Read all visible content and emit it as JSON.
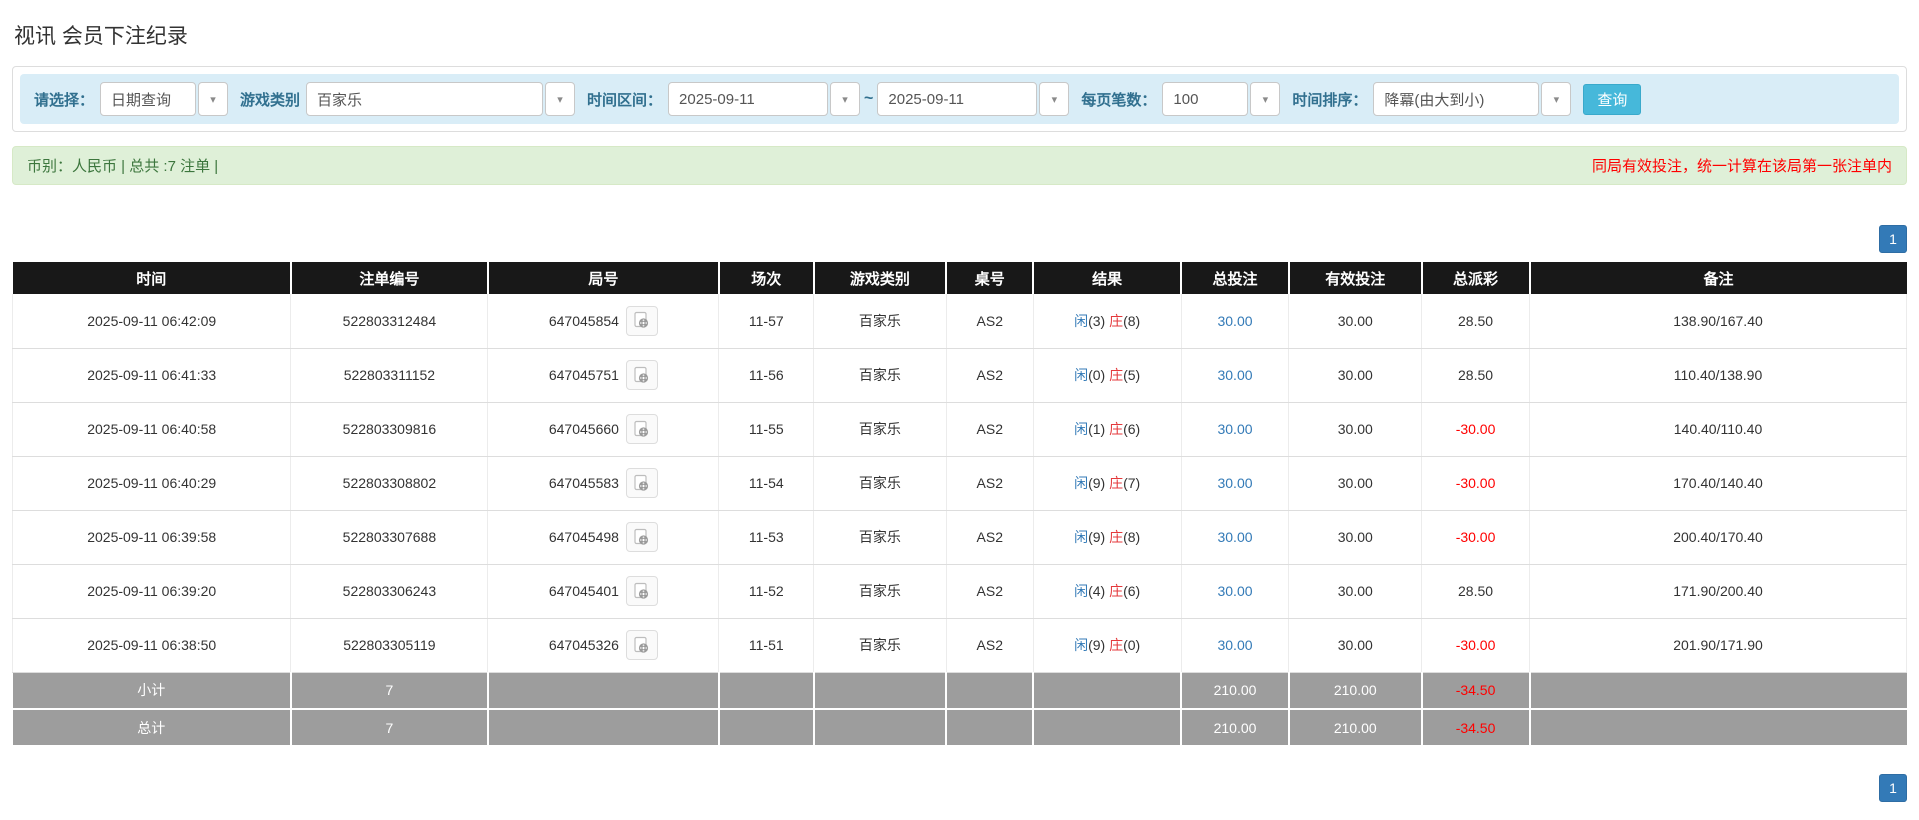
{
  "page": {
    "title": "视讯 会员下注纪录"
  },
  "filters": {
    "select_label": "请选择：",
    "select_value": "日期查询",
    "game_label": "游戏类别",
    "game_value": "百家乐",
    "range_label": "时间区间：",
    "range_from": "2025-09-11",
    "range_sep": "~",
    "range_to": "2025-09-11",
    "per_page_label": "每页笔数：",
    "per_page_value": "100",
    "sort_label": "时间排序：",
    "sort_value": "降冪(由大到小)",
    "query_button": "查询",
    "caret_icon": "▾"
  },
  "summary": {
    "left": "币别：人民币 | 总共 :7 注单 |",
    "right": "同局有效投注，统一计算在该局第一张注单内"
  },
  "pagination": {
    "page": "1"
  },
  "table": {
    "headers": [
      "时间",
      "注单编号",
      "局号",
      "场次",
      "游戏类别",
      "桌号",
      "结果",
      "总投注",
      "有效投注",
      "总派彩",
      "备注"
    ],
    "rows": [
      {
        "time": "2025-09-11 06:42:09",
        "bet_id": "522803312484",
        "round_id": "647045854",
        "session": "11-57",
        "game": "百家乐",
        "table_no": "AS2",
        "p_label": "闲",
        "p_num": "(3)",
        "b_label": "庄",
        "b_num": "(8)",
        "total_bet": "30.00",
        "valid_bet": "30.00",
        "payout": "28.50",
        "remark": "138.90/167.40"
      },
      {
        "time": "2025-09-11 06:41:33",
        "bet_id": "522803311152",
        "round_id": "647045751",
        "session": "11-56",
        "game": "百家乐",
        "table_no": "AS2",
        "p_label": "闲",
        "p_num": "(0)",
        "b_label": "庄",
        "b_num": "(5)",
        "total_bet": "30.00",
        "valid_bet": "30.00",
        "payout": "28.50",
        "remark": "110.40/138.90"
      },
      {
        "time": "2025-09-11 06:40:58",
        "bet_id": "522803309816",
        "round_id": "647045660",
        "session": "11-55",
        "game": "百家乐",
        "table_no": "AS2",
        "p_label": "闲",
        "p_num": "(1)",
        "b_label": "庄",
        "b_num": "(6)",
        "total_bet": "30.00",
        "valid_bet": "30.00",
        "payout": "-30.00",
        "remark": "140.40/110.40"
      },
      {
        "time": "2025-09-11 06:40:29",
        "bet_id": "522803308802",
        "round_id": "647045583",
        "session": "11-54",
        "game": "百家乐",
        "table_no": "AS2",
        "p_label": "闲",
        "p_num": "(9)",
        "b_label": "庄",
        "b_num": "(7)",
        "total_bet": "30.00",
        "valid_bet": "30.00",
        "payout": "-30.00",
        "remark": "170.40/140.40"
      },
      {
        "time": "2025-09-11 06:39:58",
        "bet_id": "522803307688",
        "round_id": "647045498",
        "session": "11-53",
        "game": "百家乐",
        "table_no": "AS2",
        "p_label": "闲",
        "p_num": "(9)",
        "b_label": "庄",
        "b_num": "(8)",
        "total_bet": "30.00",
        "valid_bet": "30.00",
        "payout": "-30.00",
        "remark": "200.40/170.40"
      },
      {
        "time": "2025-09-11 06:39:20",
        "bet_id": "522803306243",
        "round_id": "647045401",
        "session": "11-52",
        "game": "百家乐",
        "table_no": "AS2",
        "p_label": "闲",
        "p_num": "(4)",
        "b_label": "庄",
        "b_num": "(6)",
        "total_bet": "30.00",
        "valid_bet": "30.00",
        "payout": "28.50",
        "remark": "171.90/200.40"
      },
      {
        "time": "2025-09-11 06:38:50",
        "bet_id": "522803305119",
        "round_id": "647045326",
        "session": "11-51",
        "game": "百家乐",
        "table_no": "AS2",
        "p_label": "闲",
        "p_num": "(9)",
        "b_label": "庄",
        "b_num": "(0)",
        "total_bet": "30.00",
        "valid_bet": "30.00",
        "payout": "-30.00",
        "remark": "201.90/171.90"
      }
    ],
    "subtotal": {
      "label": "小计",
      "count": "7",
      "total_bet": "210.00",
      "valid_bet": "210.00",
      "payout": "-34.50"
    },
    "grand_total": {
      "label": "总计",
      "count": "7",
      "total_bet": "210.00",
      "valid_bet": "210.00",
      "payout": "-34.50"
    }
  },
  "colors": {
    "filter_bar_bg": "#d9edf7",
    "filter_label": "#31708f",
    "query_button_bg": "#46b8da",
    "summary_bg": "#dff0d8",
    "summary_text": "#3c763d",
    "notice_red": "#ff0000",
    "header_bg": "#181818",
    "link_blue": "#337ab7",
    "player_blue": "#337ab7",
    "banker_red": "#e4393c",
    "negative_red": "#ff0000",
    "total_row_bg": "#9d9d9d",
    "pager_bg": "#337ab7"
  }
}
